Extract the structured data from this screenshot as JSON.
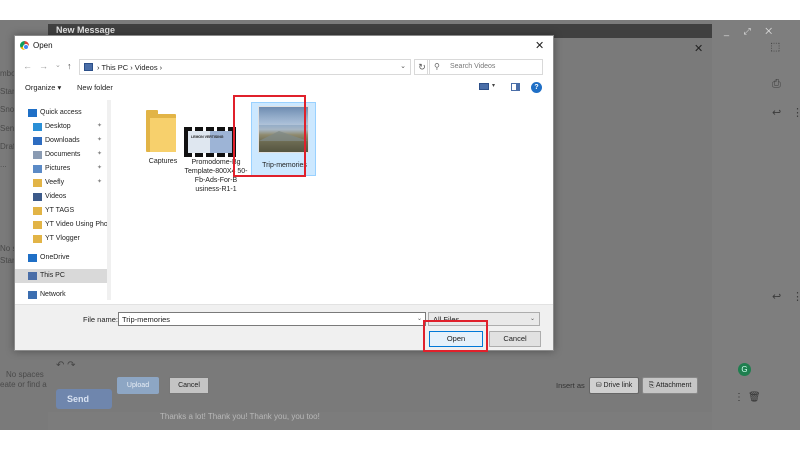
{
  "background": {
    "compose_title": "New Message",
    "compose_controls": "_ ⤢ ✕",
    "left_snippets": [
      "mbo",
      "Star",
      "Snoo",
      "Sent",
      "Draft",
      "...",
      "No s",
      "Star"
    ],
    "no_spaces": "No spaces",
    "create_find": "eate or find a",
    "upload_label": "Upload",
    "cancel_label": "Cancel",
    "insert_as": "Insert as",
    "drive_link": "Drive link",
    "attachment": "Attachment",
    "send_label": "Send",
    "smart_replies": "Thanks a lot!        Thank you!        Thank you, you too!",
    "grammarly": "G"
  },
  "dialog": {
    "title": "Open",
    "close_glyph": "✕",
    "nav": {
      "back": "←",
      "forward": "→",
      "history": "⌄",
      "up": "↑"
    },
    "address": {
      "crumbs": "›  This PC  ›  Videos  ›",
      "dropdown": "⌄",
      "refresh": "↻"
    },
    "search": {
      "icon": "⚲",
      "placeholder": "Search Videos"
    },
    "toolbar": {
      "organize": "Organize ▾",
      "new_folder": "New folder",
      "view_dd": "▾",
      "help": "?"
    },
    "sidebar": [
      {
        "label": "Quick access",
        "icon": "star-icon",
        "color": "#1f6fc6",
        "pin": false,
        "indent": 0
      },
      {
        "label": "Desktop",
        "icon": "desktop-icon",
        "color": "#2a8fd6",
        "pin": true,
        "indent": 1
      },
      {
        "label": "Downloads",
        "icon": "download-icon",
        "color": "#2d6cc0",
        "pin": true,
        "indent": 1
      },
      {
        "label": "Documents",
        "icon": "documents-icon",
        "color": "#8a9bb3",
        "pin": true,
        "indent": 1
      },
      {
        "label": "Pictures",
        "icon": "pictures-icon",
        "color": "#5b8ac6",
        "pin": true,
        "indent": 1
      },
      {
        "label": "Veefly",
        "icon": "folder-icon",
        "color": "#e2b446",
        "pin": true,
        "indent": 1
      },
      {
        "label": "Videos",
        "icon": "videos-icon",
        "color": "#3c5a8a",
        "pin": false,
        "indent": 1
      },
      {
        "label": "YT TAGS",
        "icon": "folder-icon",
        "color": "#e2b446",
        "pin": false,
        "indent": 1
      },
      {
        "label": "YT Video Using Pho",
        "icon": "folder-icon",
        "color": "#e2b446",
        "pin": false,
        "indent": 1
      },
      {
        "label": "YT Vlogger",
        "icon": "folder-icon",
        "color": "#e2b446",
        "pin": false,
        "indent": 1
      },
      {
        "label": "OneDrive",
        "icon": "cloud-icon",
        "color": "#1f6fc6",
        "pin": false,
        "indent": 0
      },
      {
        "label": "This PC",
        "icon": "pc-icon",
        "color": "#4a6ea8",
        "pin": false,
        "indent": 0,
        "selected": true
      },
      {
        "label": "Network",
        "icon": "network-icon",
        "color": "#3c6eb0",
        "pin": false,
        "indent": 0
      }
    ],
    "pin_glyph": "📌",
    "files": [
      {
        "name": "Captures",
        "type": "folder"
      },
      {
        "name": "Promodome-Bg Template-800X4 50-Fb-Ads-For-B usiness-R1-1",
        "type": "video"
      },
      {
        "name": "Trip-memories",
        "type": "video",
        "selected": true
      }
    ],
    "video_thumb_text": "LEMON VERTISING",
    "file_name_label": "File name:",
    "file_name_value": "Trip-memories",
    "file_type_value": "All Files",
    "dropdown_glyph": "⌄",
    "open_label": "Open",
    "cancel_label": "Cancel"
  },
  "colors": {
    "highlight": "#e0202b",
    "selection": "#cce8ff",
    "accent": "#0078d7"
  }
}
